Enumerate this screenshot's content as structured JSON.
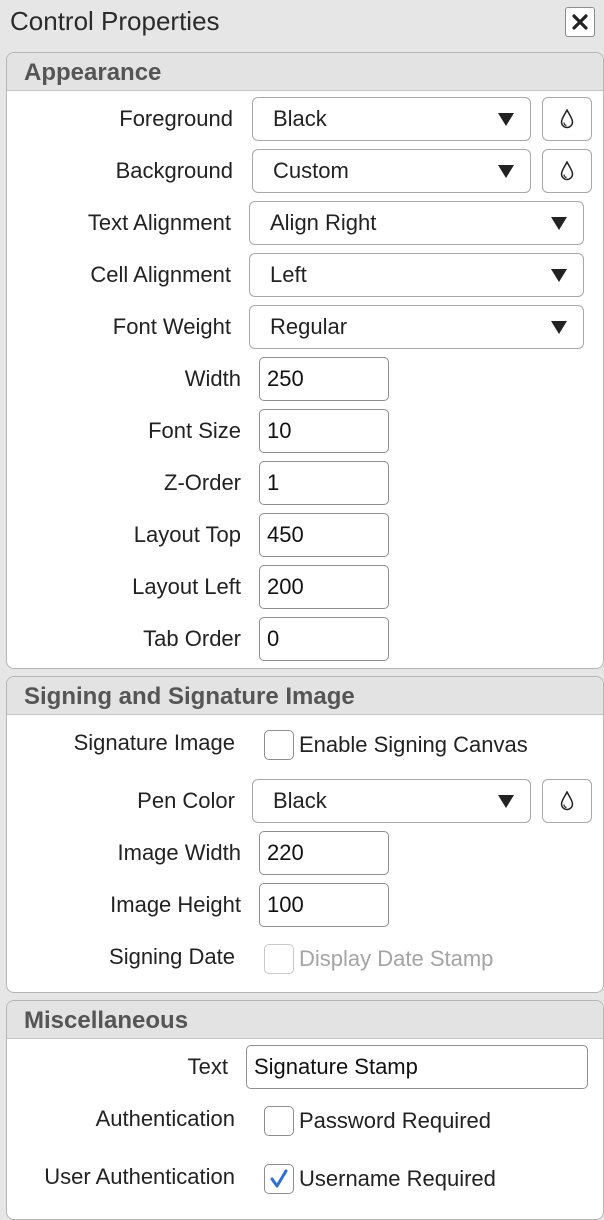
{
  "window": {
    "title": "Control Properties"
  },
  "appearance": {
    "title": "Appearance",
    "foreground": {
      "label": "Foreground",
      "value": "Black"
    },
    "background": {
      "label": "Background",
      "value": "Custom"
    },
    "text_alignment": {
      "label": "Text Alignment",
      "value": "Align Right"
    },
    "cell_alignment": {
      "label": "Cell Alignment",
      "value": "Left"
    },
    "font_weight": {
      "label": "Font Weight",
      "value": "Regular"
    },
    "width": {
      "label": "Width",
      "value": "250"
    },
    "font_size": {
      "label": "Font Size",
      "value": "10"
    },
    "z_order": {
      "label": "Z-Order",
      "value": "1"
    },
    "layout_top": {
      "label": "Layout Top",
      "value": "450"
    },
    "layout_left": {
      "label": "Layout Left",
      "value": "200"
    },
    "tab_order": {
      "label": "Tab Order",
      "value": "0"
    }
  },
  "signing": {
    "title": "Signing and Signature Image",
    "signature_image": {
      "label": "Signature Image",
      "checkbox_label": "Enable Signing Canvas",
      "checked": false
    },
    "pen_color": {
      "label": "Pen Color",
      "value": "Black"
    },
    "image_width": {
      "label": "Image Width",
      "value": "220"
    },
    "image_height": {
      "label": "Image Height",
      "value": "100"
    },
    "signing_date": {
      "label": "Signing Date",
      "checkbox_label": "Display Date Stamp",
      "checked": false,
      "disabled": true
    }
  },
  "misc": {
    "title": "Miscellaneous",
    "text": {
      "label": "Text",
      "value": "Signature Stamp"
    },
    "authentication": {
      "label": "Authentication",
      "checkbox_label": "Password Required",
      "checked": false
    },
    "user_authentication": {
      "label": "User Authentication",
      "checkbox_label": "Username Required",
      "checked": true
    }
  },
  "icons": {
    "close": "close-icon",
    "color_picker": "droplet-icon",
    "dropdown": "chevron-down-icon",
    "check": "checkmark-icon"
  },
  "colors": {
    "check_accent": "#2f6fd1",
    "section_header_bg": "#e3e3e3",
    "section_title": "#555555",
    "disabled_text": "#a4a4a4"
  }
}
